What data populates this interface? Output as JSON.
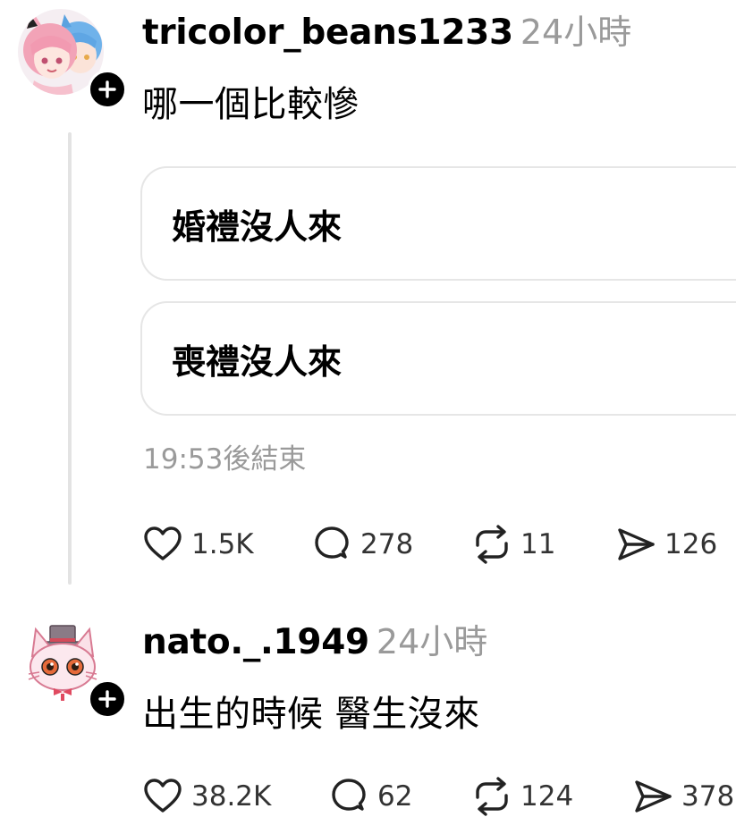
{
  "posts": [
    {
      "username": "tricolor_beans1233",
      "time": "24小時",
      "text": "哪一個比較慘",
      "avatar_icon": "anime-duo-avatar",
      "poll": {
        "options": [
          "婚禮沒人來",
          "喪禮沒人來"
        ],
        "ends": "19:53後結束"
      },
      "actions": {
        "likes": "1.5K",
        "comments": "278",
        "reposts": "11",
        "shares": "126"
      }
    },
    {
      "username": "nato._.1949",
      "time": "24小時",
      "text": "出生的時候 醫生沒來",
      "avatar_icon": "cat-top-hat-avatar",
      "actions": {
        "likes": "38.2K",
        "comments": "62",
        "reposts": "124",
        "shares": "378"
      }
    }
  ],
  "icons": {
    "like": "heart-icon",
    "comment": "speech-bubble-icon",
    "repost": "repost-arrows-icon",
    "share": "send-icon",
    "follow": "plus-icon"
  },
  "colors": {
    "text": "#000000",
    "muted": "#9a9a9a",
    "border": "#e6e6e6",
    "thread_line": "#e3e3e3"
  }
}
